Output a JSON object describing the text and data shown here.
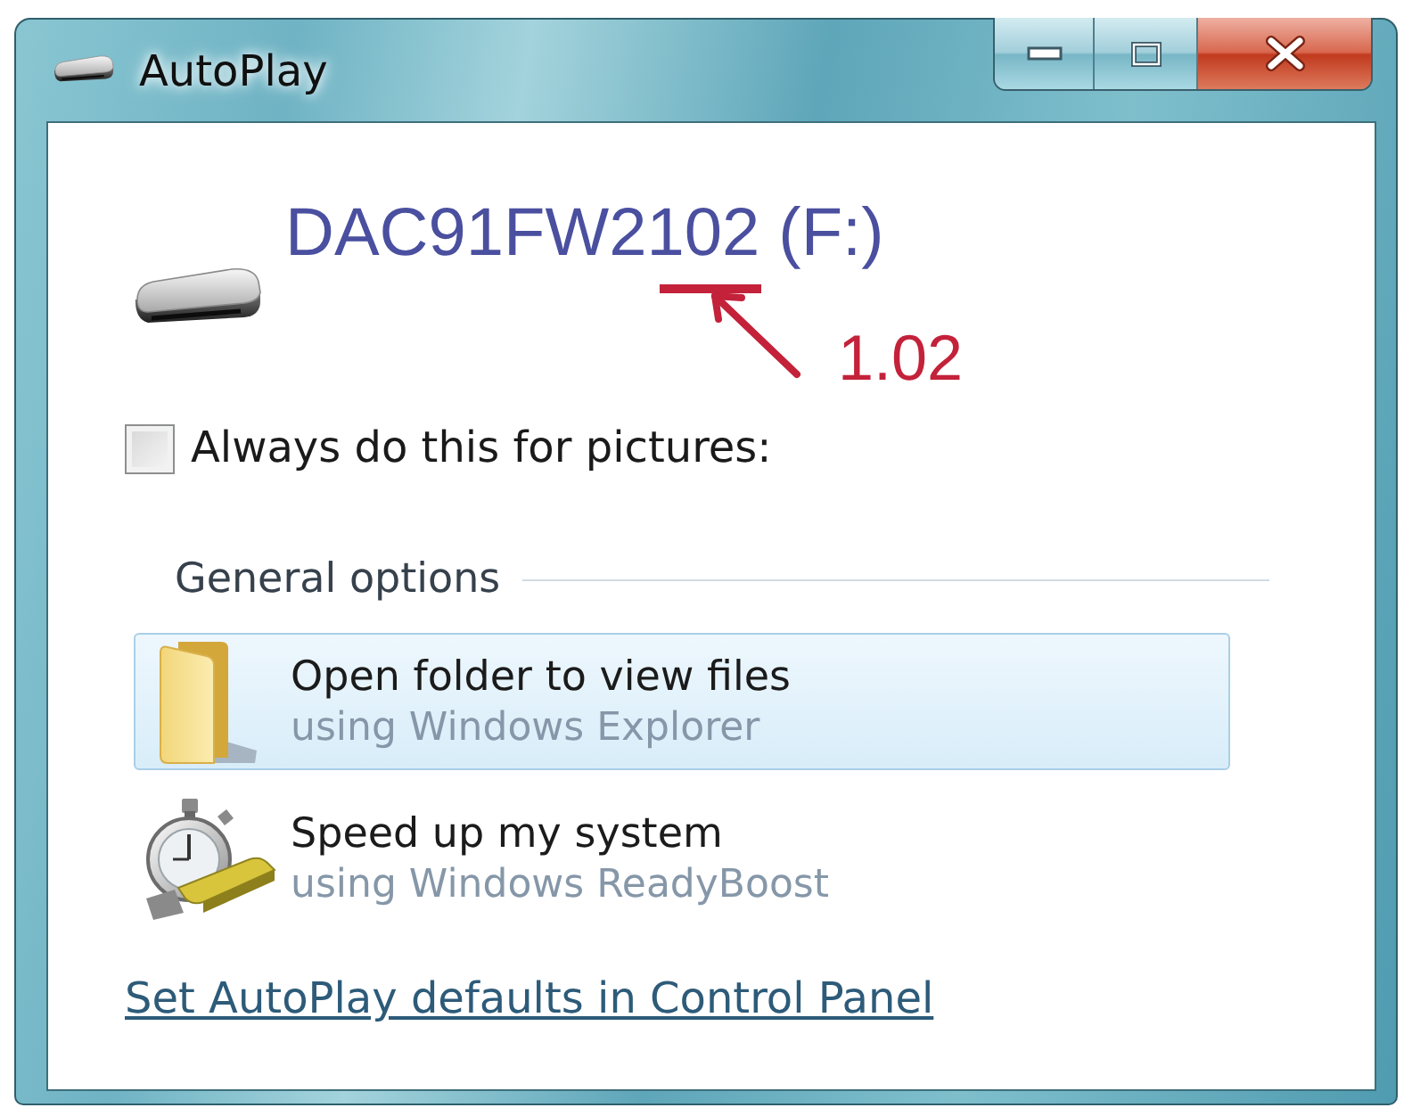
{
  "window": {
    "title": "AutoPlay"
  },
  "drive": {
    "label": "DAC91FW2102 (F:)"
  },
  "annotation": {
    "text": "1.02"
  },
  "always_checkbox": {
    "label": "Always do this for pictures:",
    "checked": false
  },
  "section": {
    "title": "General options"
  },
  "options": [
    {
      "title": "Open folder to view files",
      "subtitle": "using Windows Explorer",
      "selected": true
    },
    {
      "title": "Speed up my system",
      "subtitle": "using Windows ReadyBoost",
      "selected": false
    }
  ],
  "link": {
    "text": "Set AutoPlay defaults in Control Panel"
  }
}
